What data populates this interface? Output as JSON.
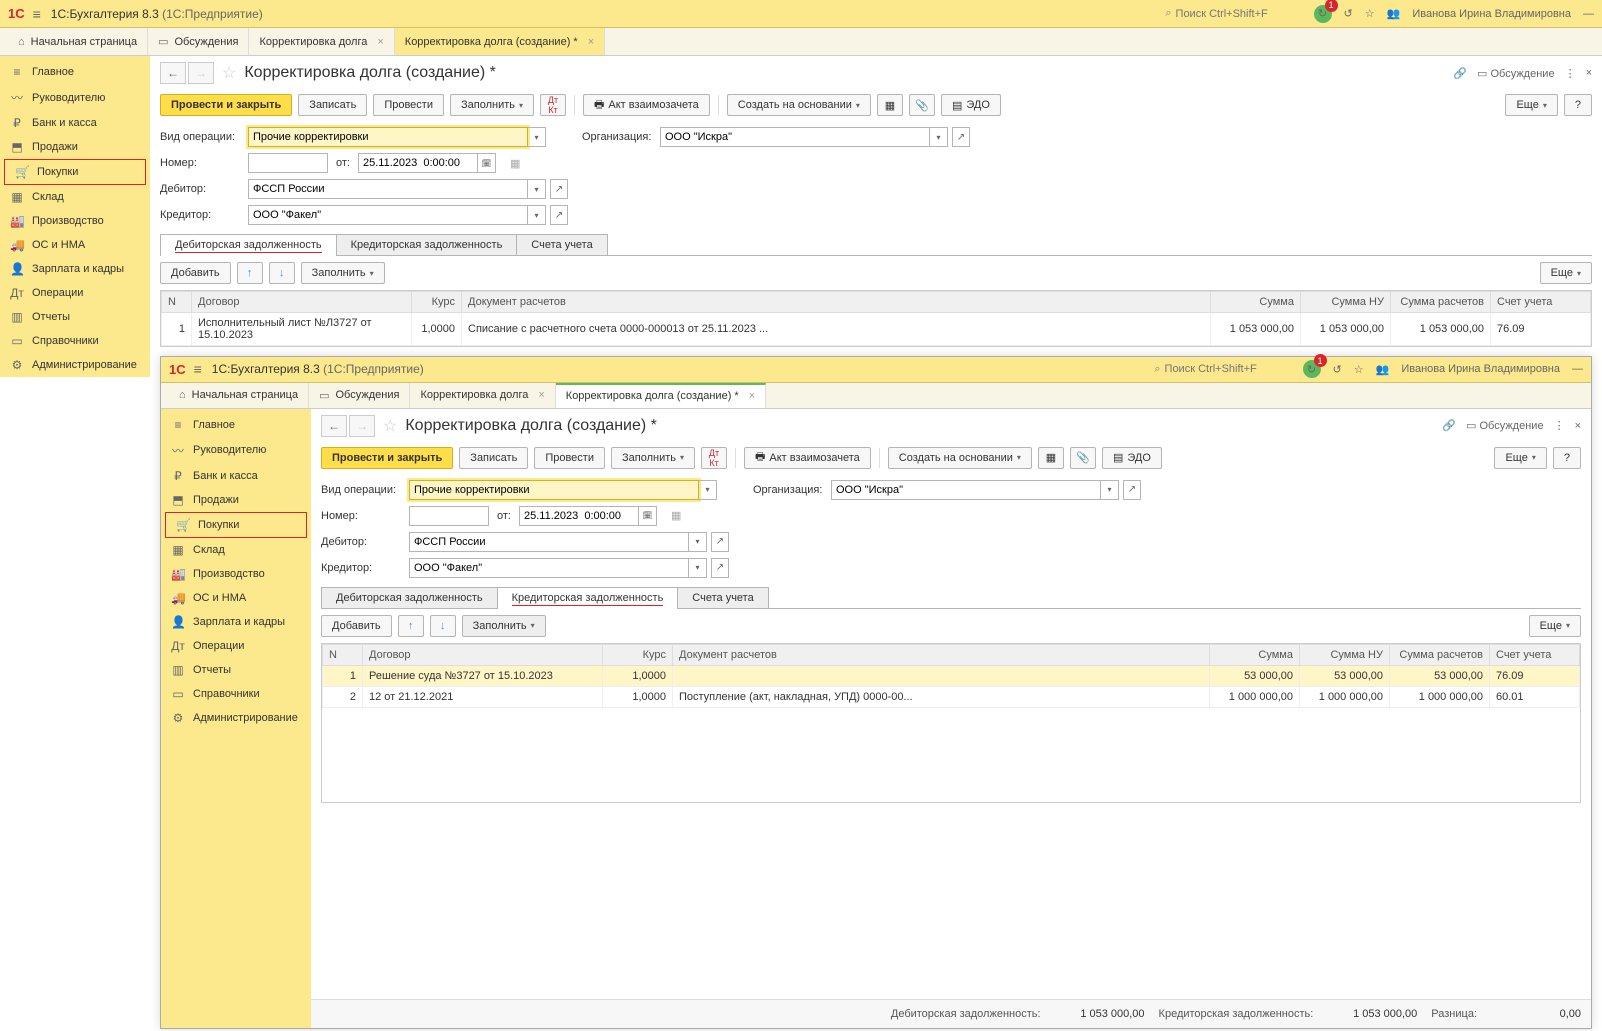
{
  "app": {
    "logo": "1С",
    "title": "1С:Бухгалтерия 8.3",
    "subtitle": "(1С:Предприятие)",
    "search_placeholder": "Поиск Ctrl+Shift+F",
    "notif_count": "1",
    "user": "Иванова Ирина Владимировна"
  },
  "sidebar": {
    "items": [
      {
        "label": "Главное"
      },
      {
        "label": "Руководителю"
      },
      {
        "label": "Банк и касса"
      },
      {
        "label": "Продажи"
      },
      {
        "label": "Покупки"
      },
      {
        "label": "Склад"
      },
      {
        "label": "Производство"
      },
      {
        "label": "ОС и НМА"
      },
      {
        "label": "Зарплата и кадры"
      },
      {
        "label": "Операции"
      },
      {
        "label": "Отчеты"
      },
      {
        "label": "Справочники"
      },
      {
        "label": "Администрирование"
      }
    ]
  },
  "tabs": {
    "home": "Начальная страница",
    "discuss": "Обсуждения",
    "t1": "Корректировка долга",
    "t2": "Корректировка долга (создание) *"
  },
  "page": {
    "title": "Корректировка долга (создание) *",
    "discuss_label": "Обсуждение"
  },
  "buttons": {
    "post_close": "Провести и закрыть",
    "save": "Записать",
    "post": "Провести",
    "fill": "Заполнить",
    "act": "Акт взаимозачета",
    "create_based": "Создать на основании",
    "edo": "ЭДО",
    "more": "Еще",
    "help": "?",
    "add": "Добавить"
  },
  "fields": {
    "op_type_lbl": "Вид операции:",
    "op_type_val": "Прочие корректировки",
    "org_lbl": "Организация:",
    "org_val": "ООО \"Искра\"",
    "number_lbl": "Номер:",
    "from_lbl": "от:",
    "date_val": "25.11.2023  0:00:00",
    "debtor_lbl": "Дебитор:",
    "debtor_val": "ФССП России",
    "creditor_lbl": "Кредитор:",
    "creditor_val": "ООО \"Факел\""
  },
  "subtabs": {
    "debit": "Дебиторская задолженность",
    "credit": "Кредиторская задолженность",
    "accounts": "Счета учета"
  },
  "table1": {
    "headers": {
      "n": "N",
      "contract": "Договор",
      "rate": "Курс",
      "doc": "Документ расчетов",
      "sum": "Сумма",
      "sum_nu": "Сумма НУ",
      "sum_calc": "Сумма расчетов",
      "account": "Счет учета"
    },
    "rows": [
      {
        "n": "1",
        "contract": "Исполнительный лист №Л3727 от 15.10.2023",
        "rate": "1,0000",
        "doc": "Списание с расчетного счета 0000-000013 от 25.11.2023 ...",
        "sum": "1 053 000,00",
        "sum_nu": "1 053 000,00",
        "sum_calc": "1 053 000,00",
        "account": "76.09"
      }
    ]
  },
  "table2": {
    "headers": {
      "n": "N",
      "contract": "Договор",
      "rate": "Курс",
      "doc": "Документ расчетов",
      "sum": "Сумма",
      "sum_nu": "Сумма НУ",
      "sum_calc": "Сумма расчетов",
      "account": "Счет учета"
    },
    "rows": [
      {
        "n": "1",
        "contract": "Решение суда №3727 от 15.10.2023",
        "rate": "1,0000",
        "doc": "",
        "sum": "53 000,00",
        "sum_nu": "53 000,00",
        "sum_calc": "53 000,00",
        "account": "76.09"
      },
      {
        "n": "2",
        "contract": "12 от 21.12.2021",
        "rate": "1,0000",
        "doc": "Поступление (акт, накладная, УПД) 0000-00...",
        "sum": "1 000 000,00",
        "sum_nu": "1 000 000,00",
        "sum_calc": "1 000 000,00",
        "account": "60.01"
      }
    ]
  },
  "totals": {
    "debit_lbl": "Дебиторская задолженность:",
    "debit_val": "1 053 000,00",
    "credit_lbl": "Кредиторская задолженность:",
    "credit_val": "1 053 000,00",
    "diff_lbl": "Разница:",
    "diff_val": "0,00"
  }
}
